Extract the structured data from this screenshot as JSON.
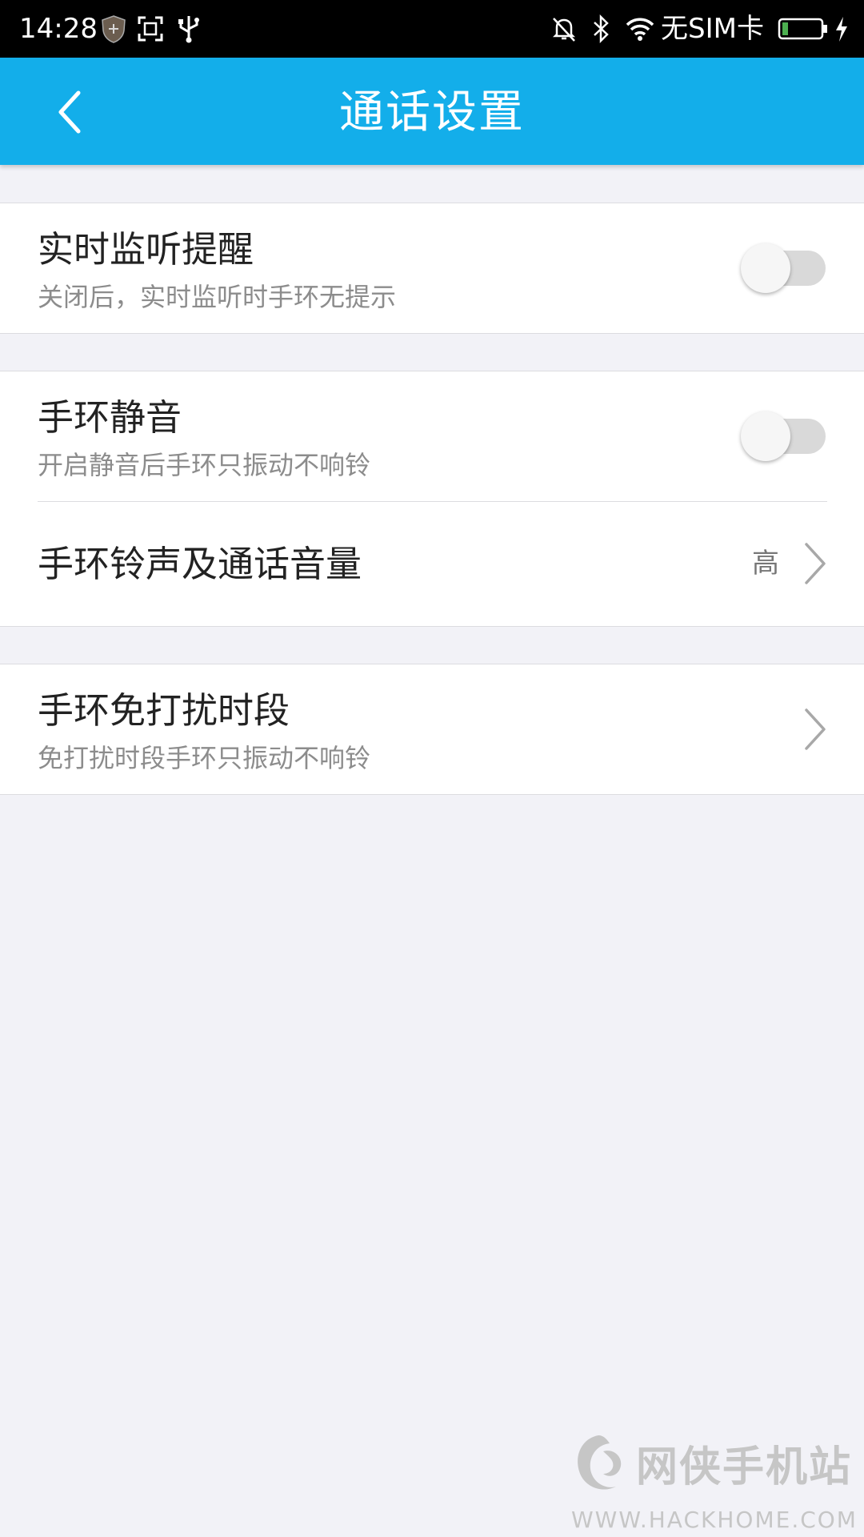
{
  "status_bar": {
    "time": "14:28",
    "carrier": "无SIM卡",
    "icons": [
      "shield-icon",
      "screenshot-icon",
      "usb-icon",
      "mute-bell-icon",
      "bluetooth-icon",
      "wifi-icon",
      "battery-icon",
      "charging-icon"
    ]
  },
  "app_bar": {
    "title": "通话设置",
    "back_icon": "chevron-left-icon",
    "color": "#13aeea"
  },
  "settings": {
    "realtime_alert": {
      "title": "实时监听提醒",
      "subtitle": "关闭后，实时监听时手环无提示",
      "enabled": false
    },
    "band_mute": {
      "title": "手环静音",
      "subtitle": "开启静音后手环只振动不响铃",
      "enabled": false
    },
    "ringtone_volume": {
      "title": "手环铃声及通话音量",
      "value": "高"
    },
    "do_not_disturb": {
      "title": "手环免打扰时段",
      "subtitle": "免打扰时段手环只振动不响铃"
    }
  },
  "watermark": {
    "text_cn": "网侠手机站",
    "text_en": "WWW.HACKHOME.COM"
  }
}
